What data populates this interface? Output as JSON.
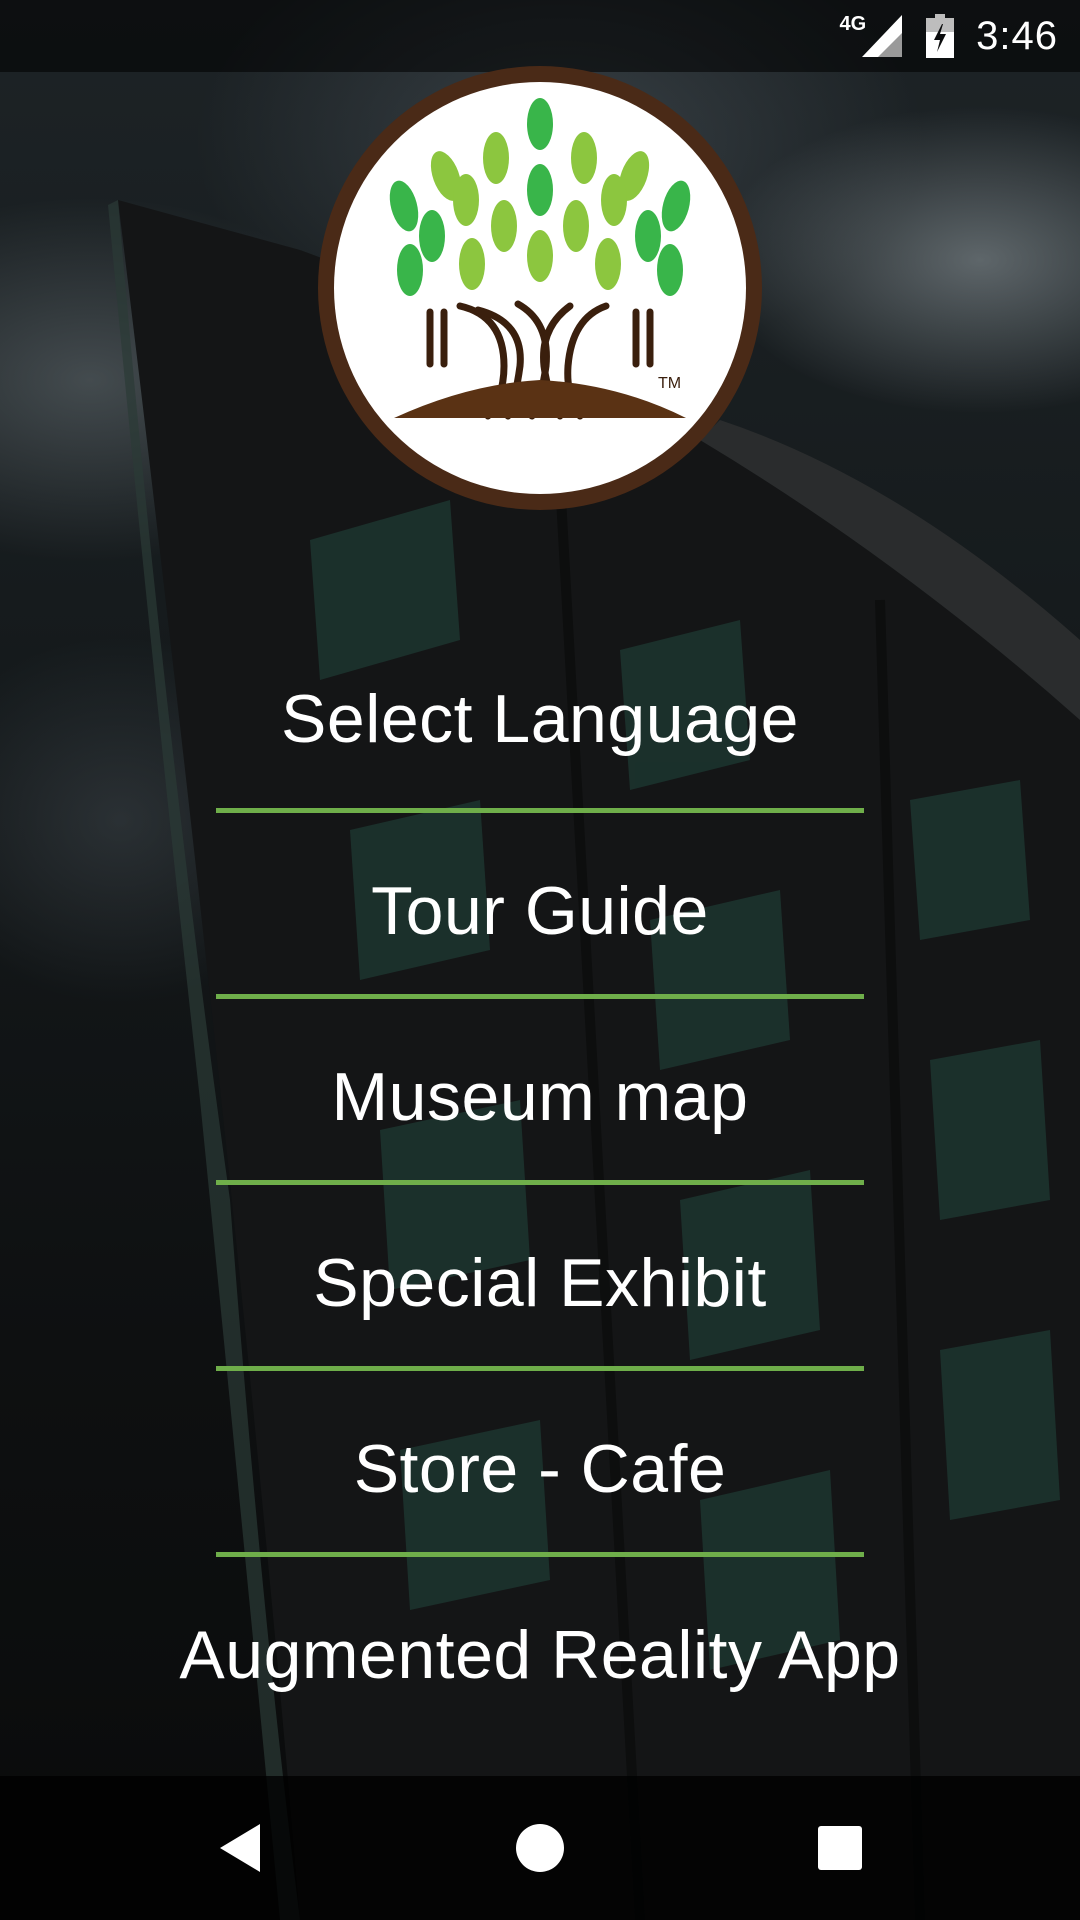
{
  "status_bar": {
    "network_type": "4G",
    "time": "3:46",
    "icons": [
      "signal-icon",
      "battery-charging-icon"
    ]
  },
  "logo": {
    "icon": "banyan-tree-logo",
    "trademark": "TM",
    "ring_color": "#4a2a17",
    "leaf_colors": [
      "#8cc63f",
      "#39b54a"
    ],
    "root_color": "#5a3214"
  },
  "menu": {
    "items": [
      {
        "label": "Select Language"
      },
      {
        "label": "Tour Guide"
      },
      {
        "label": "Museum map"
      },
      {
        "label": "Special Exhibit"
      },
      {
        "label": "Store - Cafe"
      },
      {
        "label": "Augmented Reality App"
      }
    ],
    "divider_color": "#6fae4a"
  },
  "nav_bar": {
    "buttons": [
      "back-icon",
      "home-icon",
      "recents-icon"
    ]
  }
}
